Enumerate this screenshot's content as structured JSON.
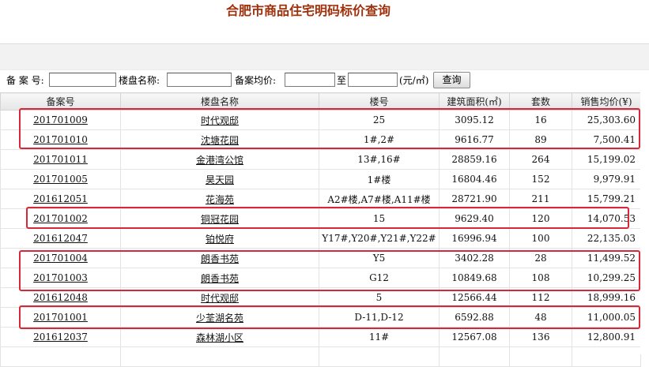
{
  "page": {
    "title": "合肥市商品住宅明码标价查询"
  },
  "search": {
    "record_label": "备 案 号:",
    "name_label": "楼盘名称:",
    "price_label": "备案均价:",
    "to_label": "至",
    "unit_label": "(元/㎡)",
    "button_label": "查询",
    "record_value": "",
    "name_value": "",
    "price_from_value": "",
    "price_to_value": ""
  },
  "table": {
    "columns": [
      "备案号",
      "楼盘名称",
      "楼号",
      "建筑面积(㎡)",
      "套数",
      "销售均价(¥)"
    ],
    "rows": [
      {
        "record": "201701009",
        "name": "时代观邸",
        "building": "25",
        "area": "3095.12",
        "units": "16",
        "price": "25,303.60"
      },
      {
        "record": "201701010",
        "name": "沈塘花园",
        "building": "1#,2#",
        "area": "9616.77",
        "units": "89",
        "price": "7,500.41"
      },
      {
        "record": "201701011",
        "name": "金港湾公馆",
        "building": "13#,16#",
        "area": "28859.16",
        "units": "264",
        "price": "15,199.02"
      },
      {
        "record": "201701005",
        "name": "昊天园",
        "building": "1#楼",
        "area": "16804.46",
        "units": "152",
        "price": "9,979.91"
      },
      {
        "record": "201612051",
        "name": "花海苑",
        "building": "A2#楼,A7#楼,A11#楼",
        "area": "28721.90",
        "units": "211",
        "price": "15,799.21"
      },
      {
        "record": "201701002",
        "name": "铜冠花园",
        "building": "15",
        "area": "9629.40",
        "units": "120",
        "price": "14,070.53"
      },
      {
        "record": "201612047",
        "name": "铂悦府",
        "building": "Y17#,Y20#,Y21#,Y22#",
        "area": "16996.94",
        "units": "100",
        "price": "22,135.03"
      },
      {
        "record": "201701004",
        "name": "朗香书苑",
        "building": "Y5",
        "area": "3402.28",
        "units": "28",
        "price": "11,499.52"
      },
      {
        "record": "201701003",
        "name": "朗香书苑",
        "building": "G12",
        "area": "10849.68",
        "units": "108",
        "price": "10,299.25"
      },
      {
        "record": "201612048",
        "name": "时代观邸",
        "building": "5",
        "area": "12566.44",
        "units": "112",
        "price": "18,999.16"
      },
      {
        "record": "201701001",
        "name": "少荃湖名苑",
        "building": "D-11,D-12",
        "area": "6592.88",
        "units": "48",
        "price": "11,000.05"
      },
      {
        "record": "201612037",
        "name": "森林湖小区",
        "building": "11#",
        "area": "12567.08",
        "units": "136",
        "price": "12,800.91"
      },
      {
        "record": "",
        "name": "",
        "building": "",
        "area": "",
        "units": "",
        "price": ""
      }
    ]
  },
  "highlight_color": "#d7283a"
}
